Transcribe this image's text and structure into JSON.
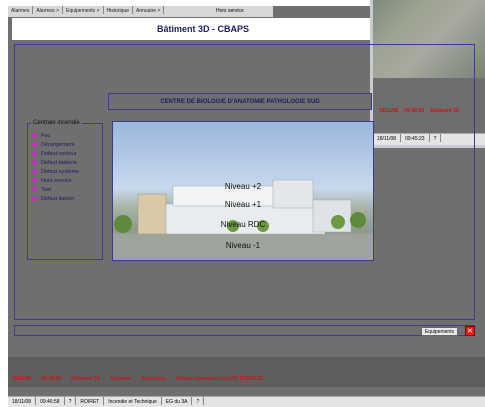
{
  "menu": {
    "items": [
      "Alarmes",
      "Alarmes >",
      "Equipements >",
      "Historique",
      "Annuaire >"
    ],
    "right": "Hors service"
  },
  "header": {
    "title": "Bâtiment 3D - CBAPS"
  },
  "building": {
    "name": "CENTRE DE BIOLOGIE D'ANATOMIE PATHOLOGIE SUD",
    "levels": [
      "Niveau +2",
      "Niveau +1",
      "Niveau RDC",
      "Niveau -1"
    ]
  },
  "centrale": {
    "title": "Centrale incendie",
    "items": [
      "Feu",
      "Dérangement",
      "Defaut secteur",
      "Defaut batterie",
      "Defaut système",
      "Hors service",
      "Test",
      "Défaut liaison"
    ]
  },
  "footer": {
    "equipments_label": "Equipements",
    "close_label": "✕"
  },
  "alarm": {
    "fields": [
      "18/11/08",
      "09:46:08",
      "Bâtiment 3A",
      "Système",
      "Apparition",
      "Défaut communication PC DTC/ELEC"
    ]
  },
  "statusbar": {
    "fields": [
      "18/11/08",
      "09:46:58",
      "?",
      "ROIRET",
      "Incendie et Technique",
      "EG du 3A",
      "?"
    ]
  },
  "overlay": {
    "alarm_fields": [
      "18/11/08",
      "09:46:08",
      "Bâtiment 3A"
    ],
    "status_fields": [
      "18/11/08",
      "09:45:23",
      "?"
    ]
  },
  "colors": {
    "accent": "#1c1c66",
    "alarm": "#c41818",
    "indicator": "#c42ec2",
    "background": "#6f6f6f"
  }
}
